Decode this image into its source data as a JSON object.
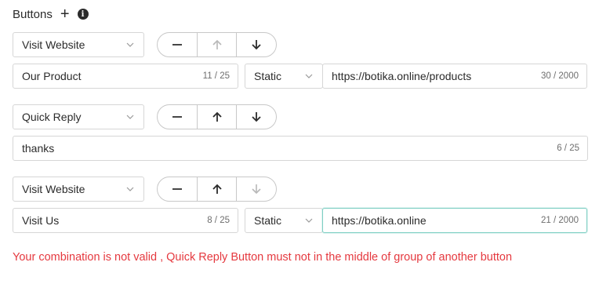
{
  "header": {
    "title": "Buttons",
    "add_symbol": "+",
    "info_symbol": "i"
  },
  "groups": [
    {
      "type": "Visit Website",
      "text_value": "Our Product",
      "text_count": "11 / 25",
      "url_type": "Static",
      "url_value": "https://botika.online/products",
      "url_count": "30 / 2000",
      "up_enabled": false,
      "down_enabled": true
    },
    {
      "type": "Quick Reply",
      "text_value": "thanks",
      "text_count": "6 / 25",
      "up_enabled": true,
      "down_enabled": true
    },
    {
      "type": "Visit Website",
      "text_value": "Visit Us",
      "text_count": "8 / 25",
      "url_type": "Static",
      "url_value": "https://botika.online",
      "url_count": "21 / 2000",
      "up_enabled": true,
      "down_enabled": false
    }
  ],
  "error_message": "Your combination is not valid , Quick Reply Button must not in the middle of group of another button",
  "colors": {
    "error": "#e5393f",
    "active_border": "#7fcfc4",
    "icon_enabled": "#2b2b2b",
    "icon_disabled": "#b8b8b8"
  }
}
